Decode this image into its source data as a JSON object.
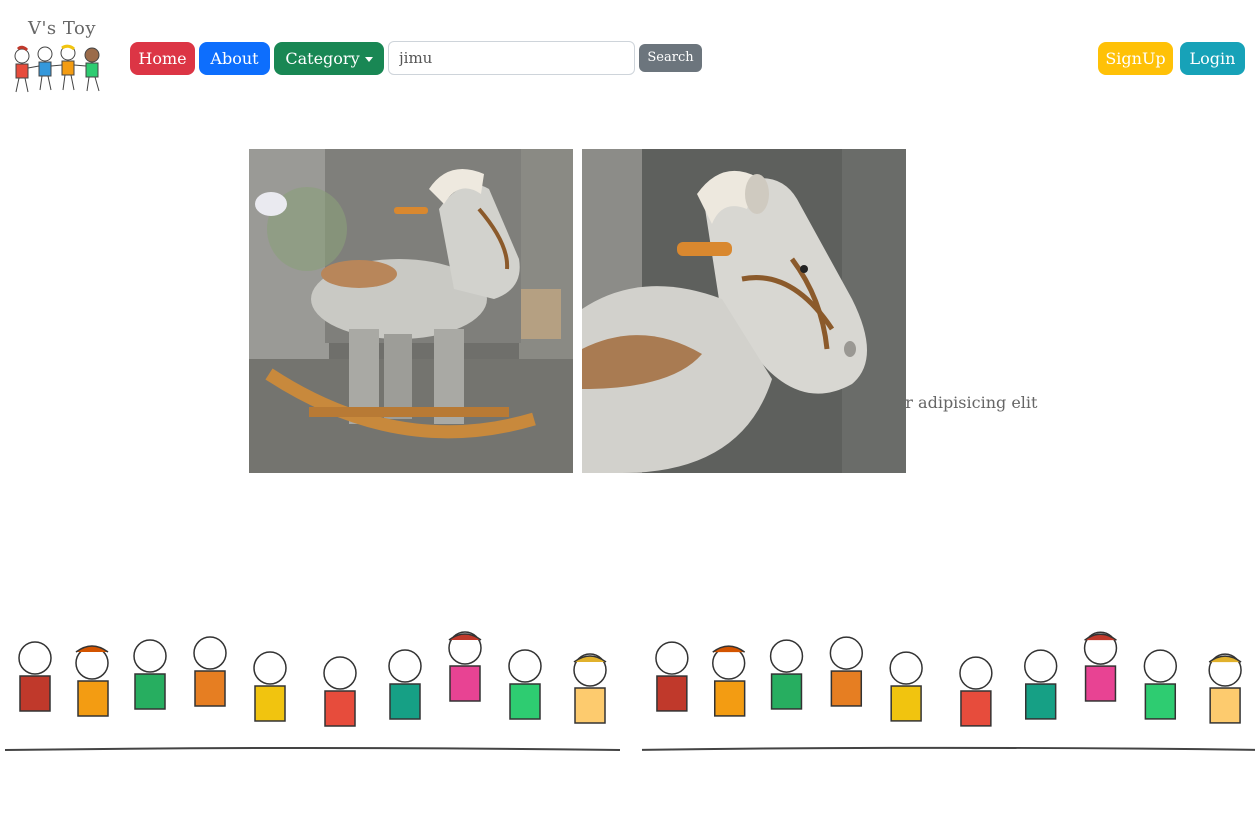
{
  "brand": {
    "title": "V's Toy",
    "logo": "kids-holding-hands-logo"
  },
  "nav": {
    "home": "Home",
    "about": "About",
    "category": "Category",
    "category_icon": "caret-down-icon"
  },
  "search": {
    "value": "jimu",
    "placeholder": "Search",
    "button": "Search"
  },
  "auth": {
    "signup": "SignUp",
    "login": "Login"
  },
  "content": {
    "caption_fragment": "ur adipisicing elit"
  },
  "colors": {
    "home": "#dc3545",
    "about": "#0d6efd",
    "category": "#198754",
    "search": "#6c757d",
    "signup": "#ffc107",
    "login": "#17a2b8"
  }
}
